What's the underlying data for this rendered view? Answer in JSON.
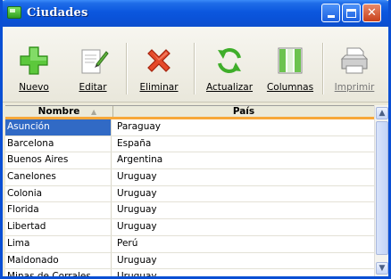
{
  "window": {
    "title": "Ciudades",
    "controls": {
      "minimize": "",
      "maximize": "",
      "close": "✕"
    }
  },
  "toolbar": {
    "buttons": [
      {
        "label": "Nuevo",
        "icon": "plus-icon"
      },
      {
        "label": "Editar",
        "icon": "edit-icon"
      },
      {
        "label": "Eliminar",
        "icon": "delete-icon"
      },
      {
        "label": "Actualizar",
        "icon": "refresh-icon"
      },
      {
        "label": "Columnas",
        "icon": "columns-icon"
      },
      {
        "label": "Imprimir",
        "icon": "printer-icon"
      }
    ]
  },
  "grid": {
    "columns": [
      "Nombre",
      "País"
    ],
    "rows": [
      {
        "nombre": "Asunción",
        "pais": "Paraguay",
        "selected": true
      },
      {
        "nombre": "Barcelona",
        "pais": "España"
      },
      {
        "nombre": "Buenos Aires",
        "pais": "Argentina"
      },
      {
        "nombre": "Canelones",
        "pais": "Uruguay"
      },
      {
        "nombre": "Colonia",
        "pais": "Uruguay"
      },
      {
        "nombre": "Florida",
        "pais": "Uruguay"
      },
      {
        "nombre": "Libertad",
        "pais": "Uruguay"
      },
      {
        "nombre": "Lima",
        "pais": "Perú"
      },
      {
        "nombre": "Maldonado",
        "pais": "Uruguay"
      },
      {
        "nombre": "Minas de Corrales",
        "pais": "Uruguay"
      }
    ]
  },
  "colors": {
    "titlebar": "#0b57de",
    "selection": "#316ac5",
    "header_accent": "#f7a83a"
  }
}
